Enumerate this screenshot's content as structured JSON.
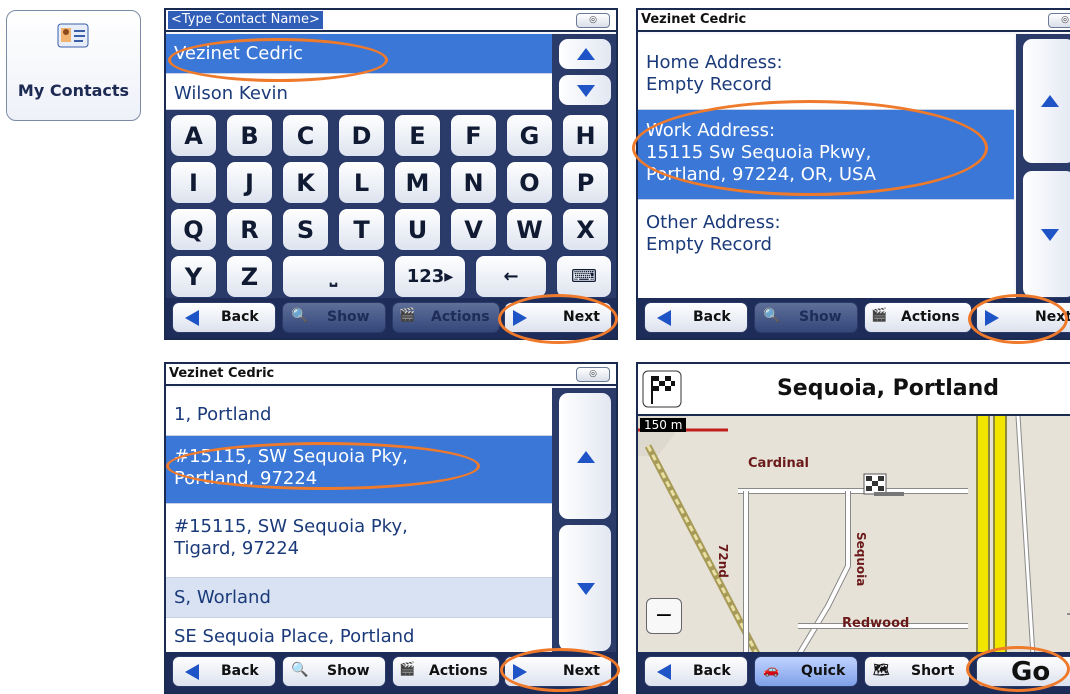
{
  "my_contacts": {
    "label": "My Contacts",
    "icon": "contact-card-icon"
  },
  "screen1": {
    "input_placeholder": "<Type Contact Name>",
    "rows": [
      "Vezinet Cedric",
      "Wilson Kevin"
    ],
    "keys_row1": [
      "A",
      "B",
      "C",
      "D",
      "E",
      "F",
      "G",
      "H"
    ],
    "keys_row2": [
      "I",
      "J",
      "K",
      "L",
      "M",
      "N",
      "O",
      "P"
    ],
    "keys_row3": [
      "Q",
      "R",
      "S",
      "T",
      "U",
      "V",
      "W",
      "X"
    ],
    "keys_row4": [
      "Y",
      "Z",
      "⎵",
      "123▸",
      "←",
      "⌨"
    ],
    "buttons": {
      "back": "Back",
      "show": "Show",
      "actions": "Actions",
      "next": "Next"
    }
  },
  "screen2": {
    "title": "Vezinet Cedric",
    "rows": [
      {
        "line1": "Home Address:",
        "line2": "Empty Record"
      },
      {
        "line1": "Work Address:",
        "line2": "15115 Sw Sequoia Pkwy,",
        "line3": "Portland, 97224, OR, USA"
      },
      {
        "line1": "Other Address:",
        "line2": "Empty Record"
      }
    ],
    "buttons": {
      "back": "Back",
      "show": "Show",
      "actions": "Actions",
      "next": "Next"
    }
  },
  "screen3": {
    "title": "Vezinet Cedric",
    "rows": [
      {
        "line1": "1, Portland"
      },
      {
        "line1": "#15115, SW Sequoia Pky,",
        "line2": "Portland, 97224"
      },
      {
        "line1": "#15115, SW Sequoia Pky,",
        "line2": "Tigard, 97224"
      },
      {
        "line1": "S, Worland"
      },
      {
        "line1": "SE Sequoia Place, Portland"
      }
    ],
    "buttons": {
      "back": "Back",
      "show": "Show",
      "actions": "Actions",
      "next": "Next"
    }
  },
  "screen4": {
    "title": "Sequoia, Portland",
    "scale": "150 m",
    "streets": [
      "Cardinal",
      "72nd",
      "Sequoia",
      "Redwood"
    ],
    "buttons": {
      "back": "Back",
      "quick": "Quick",
      "short": "Short",
      "go": "Go"
    }
  },
  "colors": {
    "accent": "#3a77d6",
    "frame": "#1d2c58",
    "highlight_oval": "#ef7a2b"
  }
}
